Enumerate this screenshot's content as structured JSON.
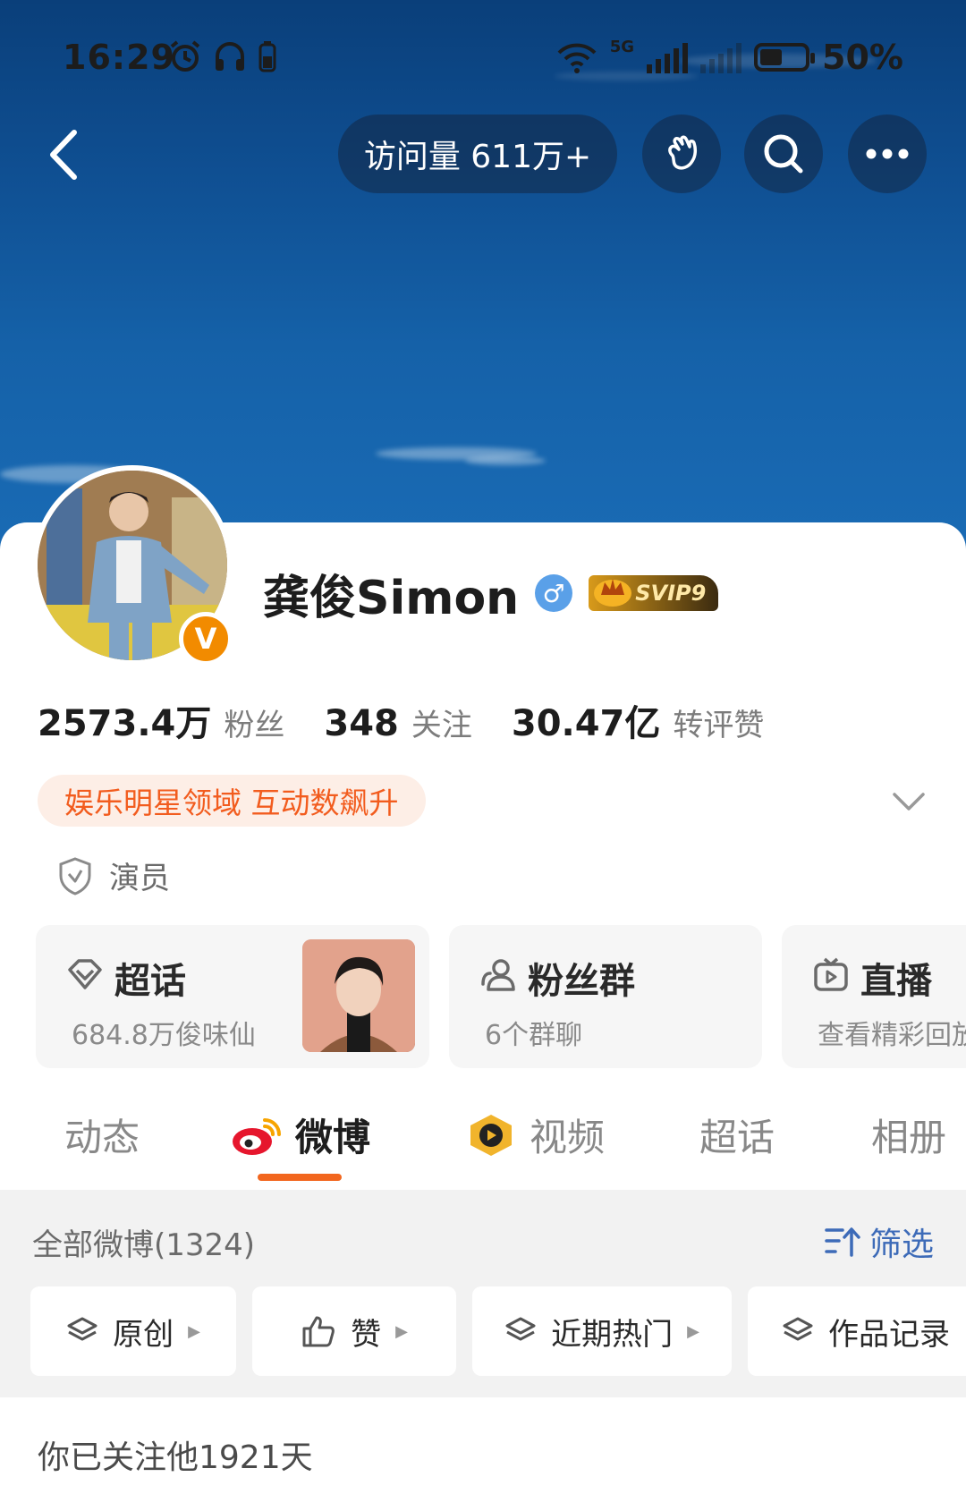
{
  "status_bar": {
    "time": "16:29",
    "battery": "50%",
    "network": "5G"
  },
  "top_nav": {
    "visits_label": "访问量 611万+"
  },
  "profile": {
    "name": "龚俊Simon",
    "gender_symbol": "♂",
    "vip_badge": "SVIP9",
    "verified_badge": "V",
    "stats": [
      {
        "value": "2573.4万",
        "label": "粉丝"
      },
      {
        "value": "348",
        "label": "关注"
      },
      {
        "value": "30.47亿",
        "label": "转评赞"
      }
    ],
    "tag": "娱乐明星领域 互动数飙升",
    "role": "演员"
  },
  "feature_cards": [
    {
      "title": "超话",
      "subtitle": "684.8万俊味仙"
    },
    {
      "title": "粉丝群",
      "subtitle": "6个群聊"
    },
    {
      "title": "直播",
      "subtitle": "查看精彩回放"
    }
  ],
  "tabs": [
    {
      "label": "动态"
    },
    {
      "label": "微博"
    },
    {
      "label": "视频"
    },
    {
      "label": "超话"
    },
    {
      "label": "相册"
    }
  ],
  "feed": {
    "title": "全部微博(1324)",
    "filter_label": "筛选",
    "chips": [
      {
        "label": "原创"
      },
      {
        "label": "赞"
      },
      {
        "label": "近期热门"
      },
      {
        "label": "作品记录"
      }
    ],
    "follow_note": "你已关注他1921天"
  },
  "colors": {
    "accent": "#f2661e",
    "tag_text": "#f25c1e",
    "tag_bg": "#fdeee6",
    "link_blue": "#3d6bb8",
    "cover_blue": "#1561a8"
  }
}
